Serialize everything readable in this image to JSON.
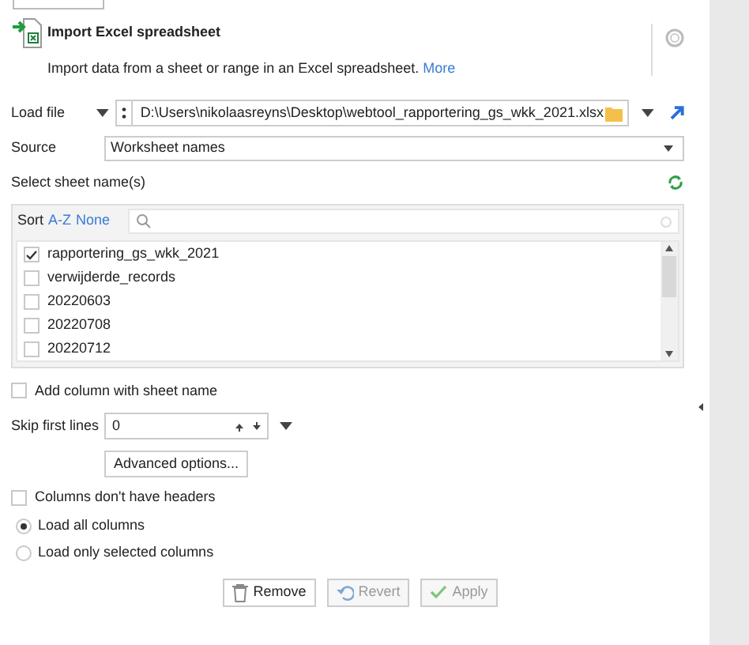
{
  "header": {
    "title": "Import Excel spreadsheet",
    "description": "Import data from a sheet or range in an Excel spreadsheet.",
    "more_link": "More"
  },
  "load_file": {
    "label": "Load file",
    "value": "D:\\Users\\nikolaasreyns\\Desktop\\webtool_rapportering_gs_wkk_2021.xlsx"
  },
  "source": {
    "label": "Source",
    "value": "Worksheet names"
  },
  "sheet_select": {
    "label": "Select sheet name(s)",
    "sort_label": "Sort",
    "sort_options": [
      "A-Z",
      "None"
    ],
    "sheets": [
      {
        "name": "rapportering_gs_wkk_2021",
        "checked": true
      },
      {
        "name": "verwijderde_records",
        "checked": false
      },
      {
        "name": "20220603",
        "checked": false
      },
      {
        "name": "20220708",
        "checked": false
      },
      {
        "name": "20220712",
        "checked": false
      }
    ]
  },
  "add_sheet_column": {
    "label": "Add column with sheet name",
    "checked": false
  },
  "skip_first_lines": {
    "label": "Skip first lines",
    "value": "0"
  },
  "advanced_button": "Advanced options...",
  "no_headers": {
    "label": "Columns don't have headers",
    "checked": false
  },
  "column_mode": [
    {
      "label": "Load all columns",
      "selected": true
    },
    {
      "label": "Load only selected columns",
      "selected": false
    }
  ],
  "buttons": [
    {
      "kind": "remove",
      "label": "Remove",
      "disabled": false
    },
    {
      "kind": "revert",
      "label": "Revert",
      "disabled": true
    },
    {
      "kind": "apply",
      "label": "Apply",
      "disabled": true
    }
  ]
}
